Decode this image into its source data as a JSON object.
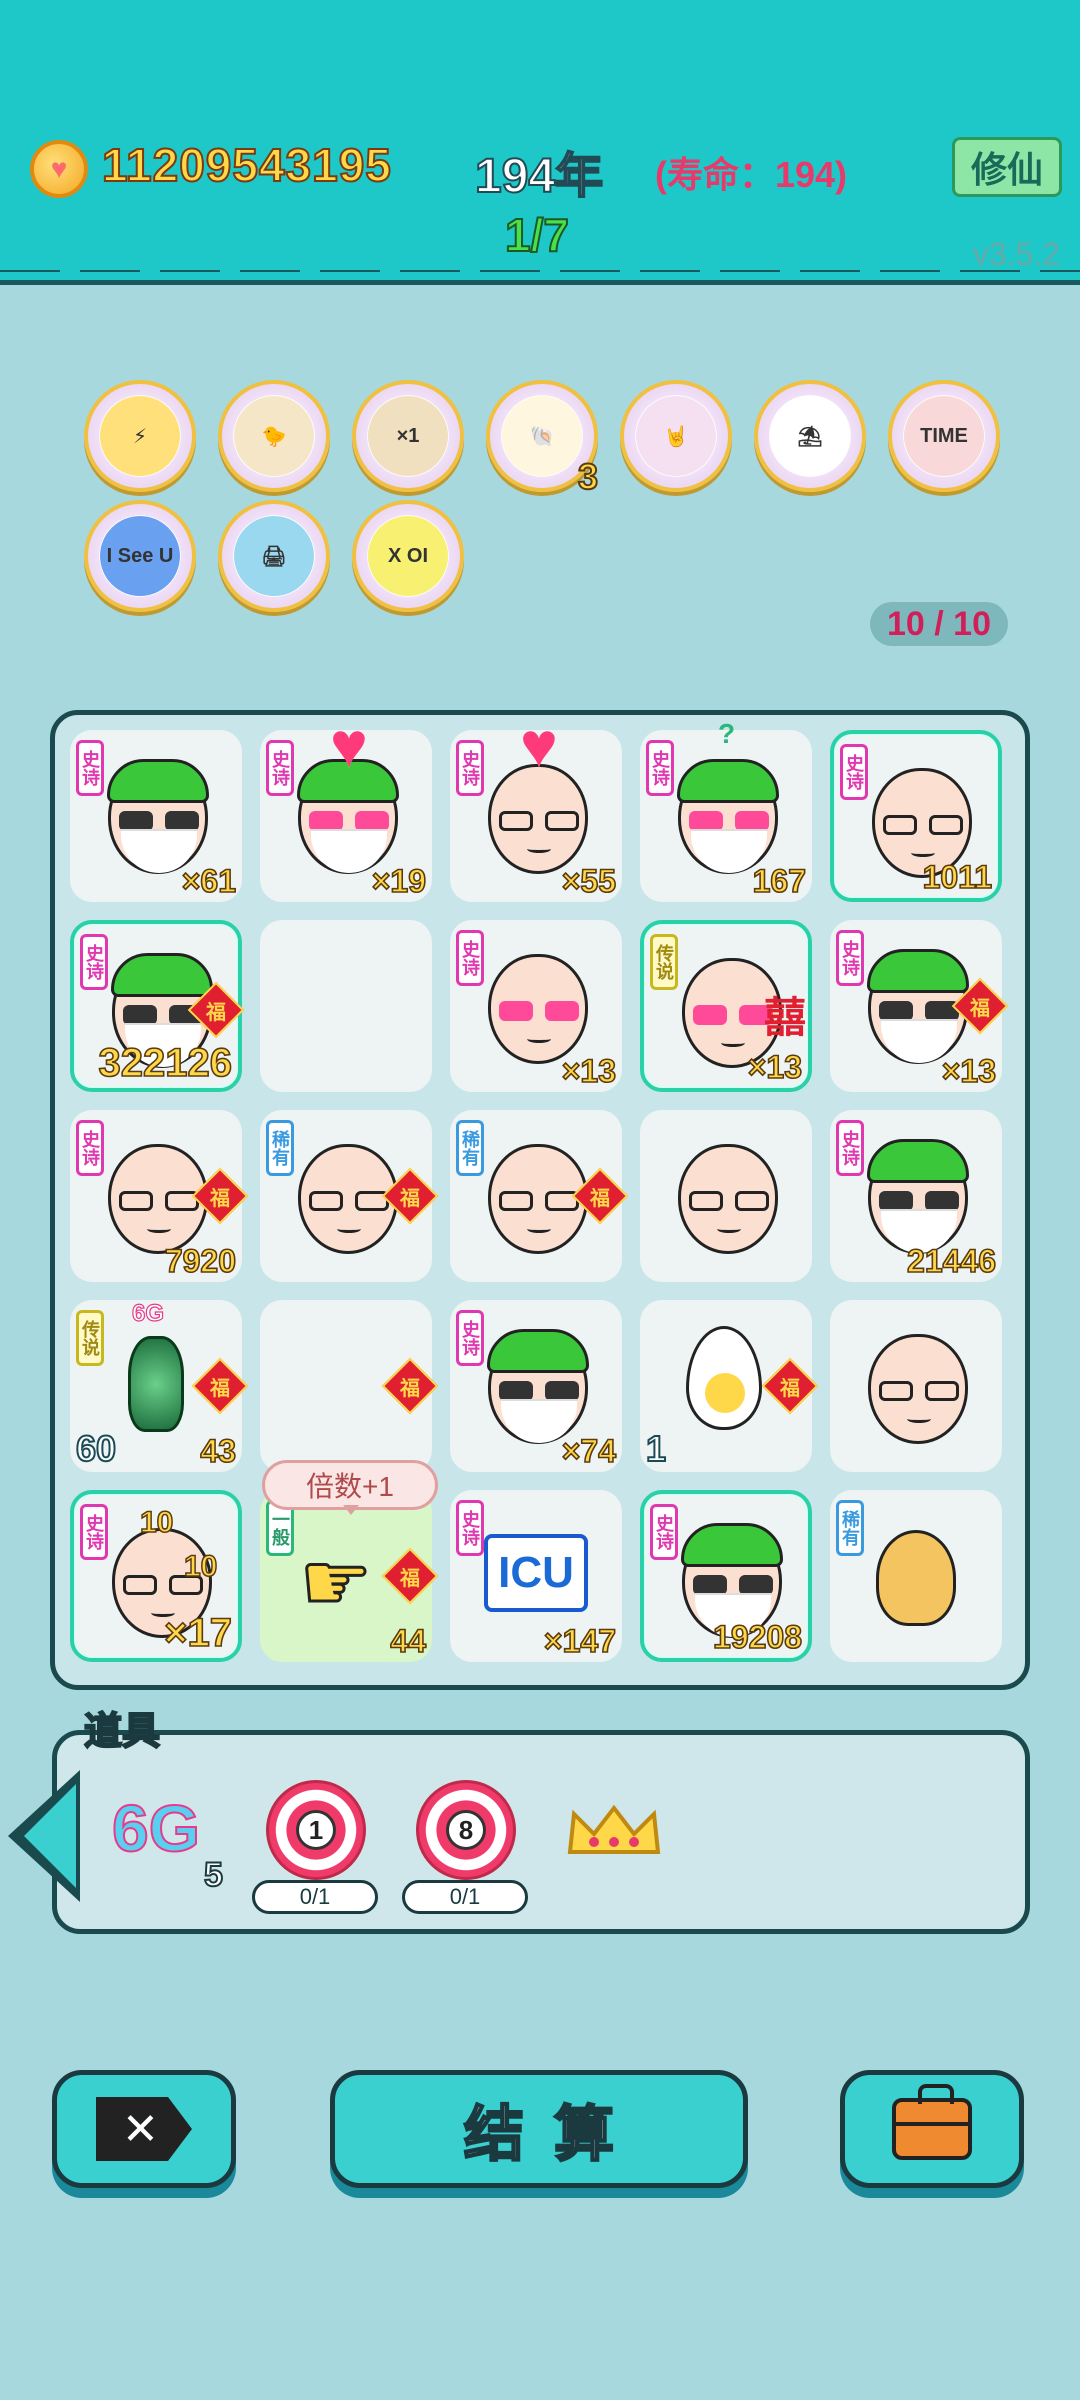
{
  "header": {
    "coins": "11209543195",
    "year": "194年",
    "lifespan": "(寿命：194)",
    "cultivate_label": "修仙",
    "round": "1/7",
    "version": "v3.5.2"
  },
  "artifacts": {
    "items": [
      {
        "name": "lightning-artifact",
        "glyph": "⚡"
      },
      {
        "name": "chick-artifact",
        "glyph": "🐤"
      },
      {
        "name": "math-head-artifact",
        "glyph": "×1"
      },
      {
        "name": "shell-artifact",
        "glyph": "🐚",
        "count": "3"
      },
      {
        "name": "rock-hand-artifact",
        "glyph": "🤘"
      },
      {
        "name": "skirt-artifact",
        "glyph": "⛱"
      },
      {
        "name": "time-magazine-artifact",
        "glyph": "TIME"
      },
      {
        "name": "i-see-u-artifact",
        "glyph": "I See U"
      },
      {
        "name": "printer-artifact",
        "glyph": "🖨"
      },
      {
        "name": "cpu-chip-artifact",
        "glyph": "X OI"
      }
    ],
    "capacity": "10 / 10"
  },
  "board": {
    "cells": [
      {
        "tag": "史诗",
        "qty": "×61"
      },
      {
        "tag": "史诗",
        "qty": "×19"
      },
      {
        "tag": "史诗",
        "qty": "×55"
      },
      {
        "tag": "史诗",
        "qty": "167"
      },
      {
        "tag": "史诗",
        "qty": "1011"
      },
      {
        "tag": "史诗",
        "qty": "322126",
        "fu": "福"
      },
      {
        "tag": "",
        "qty": ""
      },
      {
        "tag": "史诗",
        "qty": "×13"
      },
      {
        "tag": "传说",
        "qty": "×13",
        "side": "囍"
      },
      {
        "tag": "史诗",
        "qty": "×13",
        "fu": "福"
      },
      {
        "tag": "史诗",
        "qty": "7920",
        "fu": "福"
      },
      {
        "tag": "稀有",
        "qty": "",
        "fu": "福"
      },
      {
        "tag": "稀有",
        "qty": "",
        "fu": "福"
      },
      {
        "tag": "",
        "qty": ""
      },
      {
        "tag": "史诗",
        "qty": "21446"
      },
      {
        "tag": "传说",
        "qty": "43",
        "left": "60",
        "top": "6G",
        "fu": "福"
      },
      {
        "tag": "",
        "qty": "",
        "fu": "福"
      },
      {
        "tag": "史诗",
        "qty": "×74"
      },
      {
        "tag": "",
        "qty": "",
        "left": "1",
        "fu": "福"
      },
      {
        "tag": "",
        "qty": ""
      },
      {
        "tag": "史诗",
        "qty": "×17",
        "coin_a": "10",
        "coin_b": "10"
      },
      {
        "tag": "一般",
        "qty": "44",
        "fu": "福"
      },
      {
        "tag": "史诗",
        "qty": "×147",
        "center": "ICU"
      },
      {
        "tag": "史诗",
        "qty": "19208"
      },
      {
        "tag": "稀有",
        "qty": ""
      }
    ],
    "bubble": "倍数+1",
    "question": "?"
  },
  "tools": {
    "title": "道具",
    "sixg_label": "6G",
    "sixg_count": "5",
    "target_1": "1",
    "target_1_progress": "0/1",
    "target_8": "8",
    "target_8_progress": "0/1"
  },
  "actions": {
    "settle_label": "结算"
  },
  "colors": {
    "header": "#1ec8c8",
    "background": "#a6d8de",
    "epic_tag": "#e038b0",
    "rare_tag": "#3a9ae0",
    "legend_tag": "#c8b820",
    "button": "#3ad0d0"
  }
}
